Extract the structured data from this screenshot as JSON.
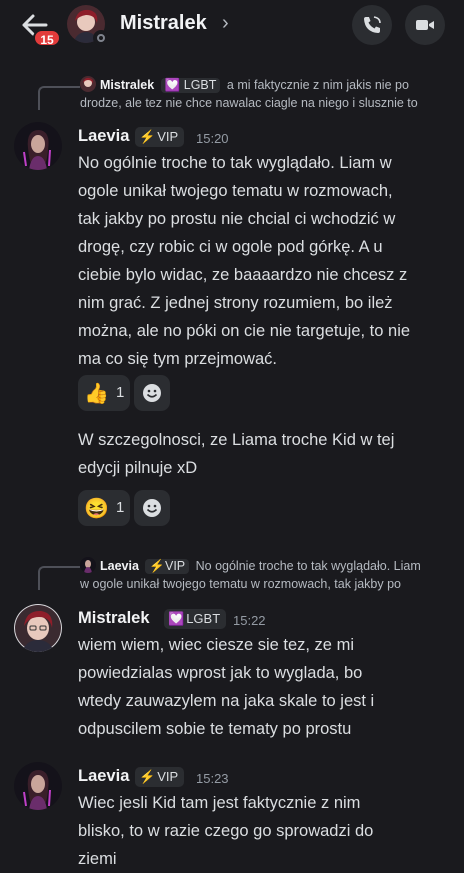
{
  "header": {
    "name": "Mistralek",
    "unread_count": "15",
    "chevron": "›"
  },
  "messages": [
    {
      "reply": {
        "author": "Mistralek",
        "tag": "LGBT",
        "line1": "a mi faktycznie z nim jakis nie po",
        "line2": "drodze, ale tez nie chce nawalac ciagle na niego i slusznie to"
      },
      "author": "Laevia",
      "tag": "VIP",
      "time": "15:20",
      "lines": [
        "No ogólnie troche to tak wyglądało. Liam w",
        "ogole unikał twojego tematu w rozmowach,",
        "tak jakby po prostu nie chcial ci wchodzić w",
        "drogę, czy robic ci w ogole pod górkę. A u",
        "ciebie bylo widac, ze baaaardzo nie chcesz z",
        "nim grać. Z jednej strony rozumiem, bo ileż",
        "można, ale no póki on cie nie targetuje, to nie",
        "ma co się tym przejmować."
      ],
      "reaction": {
        "emoji": "👍",
        "count": "1"
      }
    },
    {
      "lines": [
        "W szczegolnosci, ze Liama troche Kid w tej",
        "edycji pilnuje xD"
      ],
      "reaction": {
        "emoji": "😆",
        "count": "1"
      }
    },
    {
      "reply": {
        "author": "Laevia",
        "tag": "VIP",
        "line1": "No ogólnie troche to tak wyglądało. Liam",
        "line2": "w ogole unikał twojego tematu w rozmowach, tak jakby po"
      },
      "author": "Mistralek",
      "tag": "LGBT",
      "time": "15:22",
      "lines": [
        "wiem wiem, wiec ciesze sie tez, ze mi",
        "powiedzialas wprost jak to wyglada, bo",
        "wtedy zauwazylem na jaka skale to jest i",
        "odpuscilem sobie te tematy po prostu"
      ]
    },
    {
      "author": "Laevia",
      "tag": "VIP",
      "time": "15:23",
      "lines": [
        "Wiec jesli Kid tam jest faktycznie z nim",
        "blisko, to w razie czego go sprowadzi do",
        "ziemi"
      ]
    }
  ],
  "colors": {
    "background": "#1a1a1e",
    "pill": "#2b2d31",
    "badge": "#e23b3b",
    "lgbt_heart": "#e879f9",
    "vip_bolt": "#f0b232"
  },
  "icons": [
    "back-arrow-icon",
    "phone-icon",
    "video-camera-icon",
    "add-reaction-icon",
    "heart-icon",
    "lightning-icon"
  ]
}
